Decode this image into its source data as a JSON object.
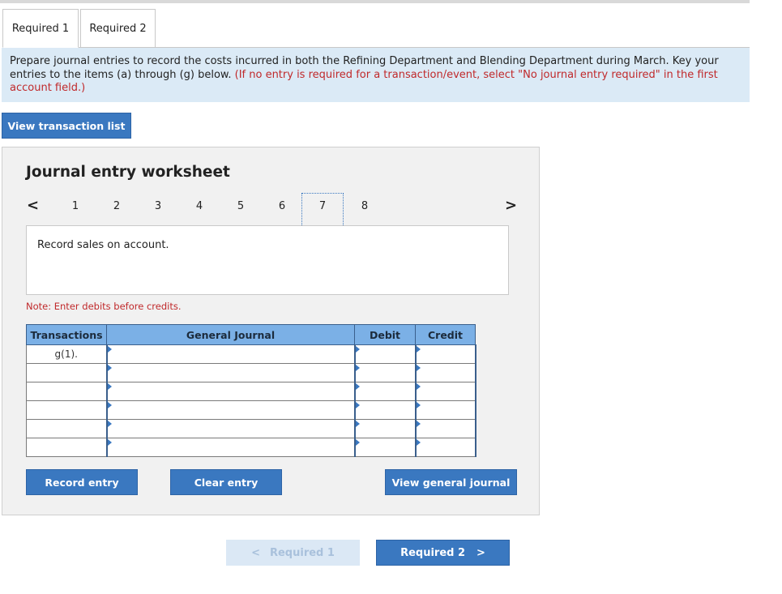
{
  "tabs": [
    {
      "label": "Required 1",
      "active": true
    },
    {
      "label": "Required 2",
      "active": false
    }
  ],
  "instructions": {
    "text": "Prepare journal entries to record the costs incurred in both the Refining Department and Blending Department during March. Key your entries to the items (a) through (g) below. ",
    "red_text": "(If no entry is required for a transaction/event, select \"No journal entry required\" in the first account field.)"
  },
  "buttons": {
    "view_transactions": "View transaction list",
    "record_entry": "Record entry",
    "clear_entry": "Clear entry",
    "view_general_journal": "View general journal"
  },
  "worksheet": {
    "title": "Journal entry worksheet",
    "pages": [
      "1",
      "2",
      "3",
      "4",
      "5",
      "6",
      "7",
      "8"
    ],
    "current_page": "7",
    "prev_icon": "<",
    "next_icon": ">",
    "description": "Record sales on account.",
    "note": "Note: Enter debits before credits."
  },
  "journal": {
    "headers": {
      "transactions": "Transactions",
      "general_journal": "General Journal",
      "debit": "Debit",
      "credit": "Credit"
    },
    "rows": [
      {
        "transaction": "g(1).",
        "account": "",
        "debit": "",
        "credit": ""
      },
      {
        "transaction": "",
        "account": "",
        "debit": "",
        "credit": ""
      },
      {
        "transaction": "",
        "account": "",
        "debit": "",
        "credit": ""
      },
      {
        "transaction": "",
        "account": "",
        "debit": "",
        "credit": ""
      },
      {
        "transaction": "",
        "account": "",
        "debit": "",
        "credit": ""
      },
      {
        "transaction": "",
        "account": "",
        "debit": "",
        "credit": ""
      }
    ]
  },
  "nav": {
    "prev_label": "Required 1",
    "next_label": "Required 2",
    "prev_arrow": "<",
    "next_arrow": ">"
  },
  "colors": {
    "primary_button": "#3a78c0",
    "header_blue": "#7bb0e6",
    "instruction_bg": "#dbeaf6",
    "alert_red": "#c0292b"
  }
}
